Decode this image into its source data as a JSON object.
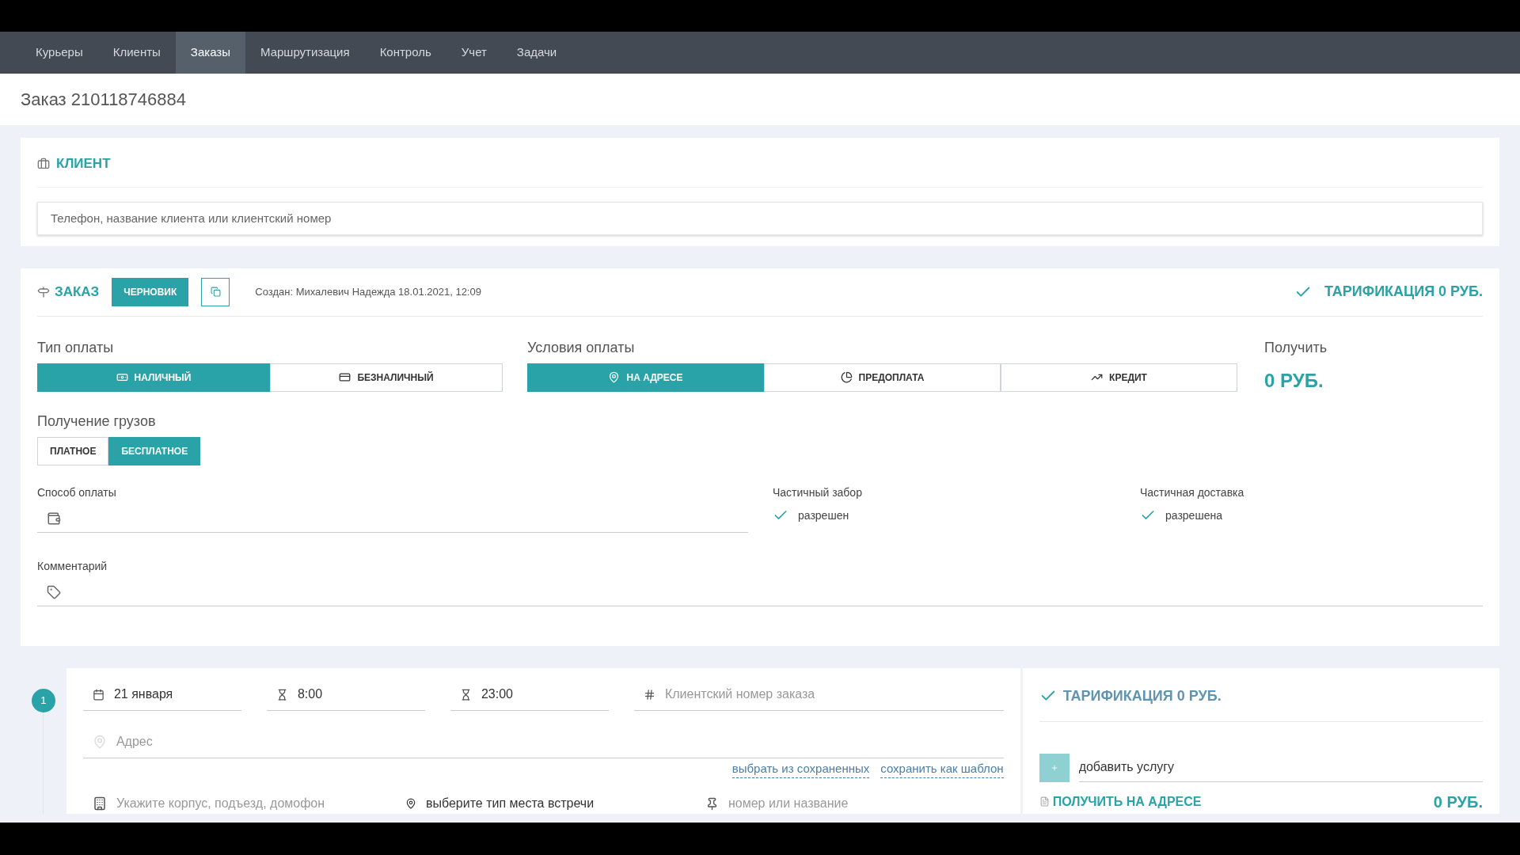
{
  "nav": [
    {
      "label": "Курьеры",
      "selected": false
    },
    {
      "label": "Клиенты",
      "selected": false
    },
    {
      "label": "Заказы",
      "selected": true
    },
    {
      "label": "Маршрутизация",
      "selected": false
    },
    {
      "label": "Контроль",
      "selected": false
    },
    {
      "label": "Учет",
      "selected": false
    },
    {
      "label": "Задачи",
      "selected": false
    }
  ],
  "title": "Заказ 210118746884",
  "client": {
    "heading": "КЛИЕНТ",
    "search_placeholder": "Телефон, название клиента или клиентский номер"
  },
  "order": {
    "heading": "ЗАКАЗ",
    "status": "ЧЕРНОВИК",
    "created": "Создан: Михалевич Надежда 18.01.2021, 12:09",
    "tariff": "ТАРИФИКАЦИЯ 0 РУБ.",
    "payment_type": {
      "label": "Тип оплаты",
      "options": [
        {
          "label": "НАЛИЧНЫЙ",
          "selected": true
        },
        {
          "label": "БЕЗНАЛИЧНЫЙ",
          "selected": false
        }
      ]
    },
    "payment_terms": {
      "label": "Условия оплаты",
      "options": [
        {
          "label": "НА АДРЕСЕ",
          "selected": true
        },
        {
          "label": "ПРЕДОПЛАТА",
          "selected": false
        },
        {
          "label": "КРЕДИТ",
          "selected": false
        }
      ]
    },
    "receive": {
      "label": "Получить",
      "amount": "0 РУБ."
    },
    "cargo": {
      "label": "Получение грузов",
      "options": [
        {
          "label": "ПЛАТНОЕ",
          "selected": false
        },
        {
          "label": "БЕСПЛАТНОЕ",
          "selected": true
        }
      ]
    },
    "payment_method": {
      "label": "Способ оплаты"
    },
    "partial_pickup": {
      "label": "Частичный забор",
      "value": "разрешен",
      "checked": true
    },
    "partial_delivery": {
      "label": "Частичная доставка",
      "value": "разрешена",
      "checked": true
    },
    "comment": {
      "label": "Комментарий"
    }
  },
  "route": {
    "number": "1",
    "date": "21 января",
    "time_from": "8:00",
    "time_to": "23:00",
    "client_number_placeholder": "Клиентский номер заказа",
    "address_placeholder": "Адрес",
    "links": [
      "выбрать из сохраненных",
      "сохранить как шаблон"
    ],
    "building_placeholder": "Укажите корпус, подъезд, домофон",
    "meeting_type": "выберите тип места встречи",
    "place_placeholder": "номер или название"
  },
  "route_tariff": {
    "tariff": "ТАРИФИКАЦИЯ 0 РУБ.",
    "add_service_placeholder": "добавить услугу",
    "receive_label": "ПОЛУЧИТЬ НА АДРЕСЕ",
    "receive_amount": "0 РУБ."
  }
}
